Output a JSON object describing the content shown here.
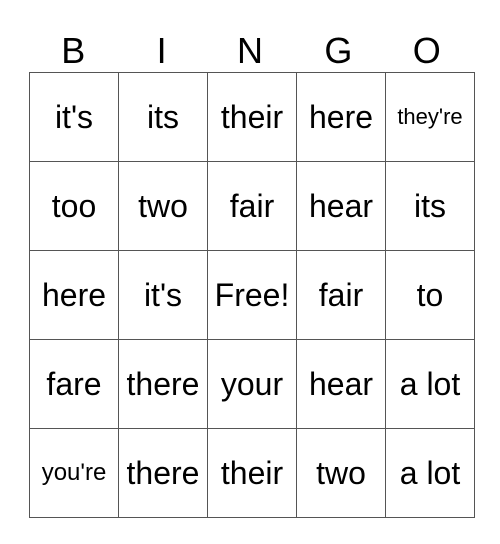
{
  "header": [
    "B",
    "I",
    "N",
    "G",
    "O"
  ],
  "rows": [
    [
      "it's",
      "its",
      "their",
      "here",
      "they're"
    ],
    [
      "too",
      "two",
      "fair",
      "hear",
      "its"
    ],
    [
      "here",
      "it's",
      "Free!",
      "fair",
      "to"
    ],
    [
      "fare",
      "there",
      "your",
      "hear",
      "a lot"
    ],
    [
      "you're",
      "there",
      "their",
      "two",
      "a lot"
    ]
  ],
  "free_space": {
    "row": 2,
    "col": 2,
    "label": "Free!"
  }
}
